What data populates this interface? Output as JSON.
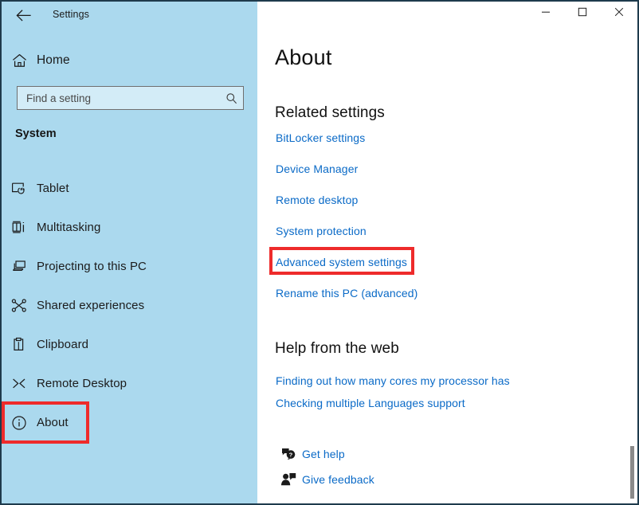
{
  "window": {
    "app_title": "Settings",
    "back_icon": "back-arrow-icon",
    "controls": {
      "minimize": "minimize-icon",
      "maximize": "maximize-icon",
      "close": "close-icon"
    },
    "accent_blue": "#1a4a7a",
    "link_blue": "#0a6ac7",
    "sidebar_bg": "#abd9ee",
    "highlight_red": "#ee2b2b"
  },
  "sidebar": {
    "home": {
      "label": "Home",
      "icon": "home-icon"
    },
    "search": {
      "placeholder": "Find a setting",
      "value": "",
      "icon": "search-icon"
    },
    "section_header": "System",
    "items": [
      {
        "label": "Tablet",
        "icon": "tablet-icon",
        "selected": false
      },
      {
        "label": "Multitasking",
        "icon": "multitasking-icon",
        "selected": false
      },
      {
        "label": "Projecting to this PC",
        "icon": "projecting-icon",
        "selected": false
      },
      {
        "label": "Shared experiences",
        "icon": "shared-experiences-icon",
        "selected": false
      },
      {
        "label": "Clipboard",
        "icon": "clipboard-icon",
        "selected": false
      },
      {
        "label": "Remote Desktop",
        "icon": "remote-desktop-icon",
        "selected": false
      },
      {
        "label": "About",
        "icon": "info-icon",
        "selected": true,
        "highlighted": true
      }
    ]
  },
  "main": {
    "page_title": "About",
    "related_settings": {
      "heading": "Related settings",
      "links": [
        {
          "label": "BitLocker settings",
          "highlighted": false
        },
        {
          "label": "Device Manager",
          "highlighted": false
        },
        {
          "label": "Remote desktop",
          "highlighted": false
        },
        {
          "label": "System protection",
          "highlighted": false
        },
        {
          "label": "Advanced system settings",
          "highlighted": true
        },
        {
          "label": "Rename this PC (advanced)",
          "highlighted": false
        }
      ]
    },
    "help_from_web": {
      "heading": "Help from the web",
      "links": [
        {
          "label": "Finding out how many cores my processor has"
        },
        {
          "label": "Checking multiple Languages support"
        }
      ]
    },
    "footer_links": [
      {
        "label": "Get help",
        "icon": "get-help-icon"
      },
      {
        "label": "Give feedback",
        "icon": "give-feedback-icon"
      }
    ]
  }
}
